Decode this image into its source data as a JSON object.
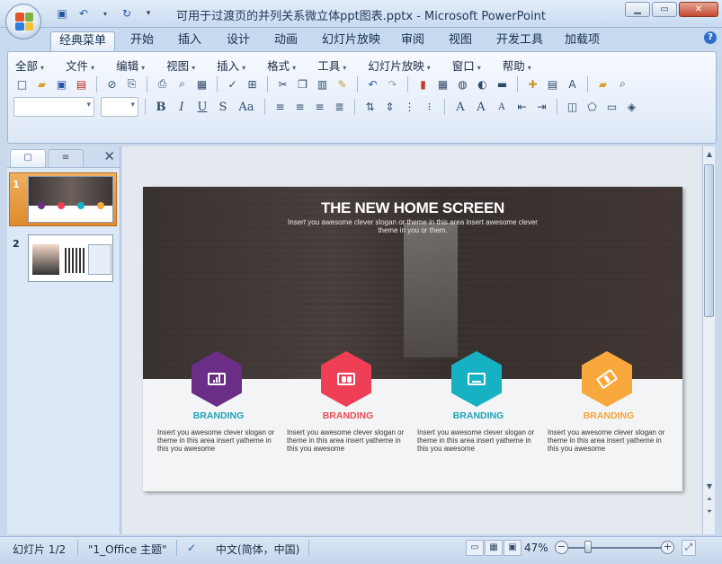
{
  "window": {
    "title": "可用于过渡页的并列关系微立体ppt图表.pptx - Microsoft PowerPoint"
  },
  "ribbon_tabs": [
    "经典菜单",
    "开始",
    "插入",
    "设计",
    "动画",
    "幻灯片放映",
    "审阅",
    "视图",
    "开发工具",
    "加载项"
  ],
  "menus": [
    "全部",
    "文件",
    "编辑",
    "视图",
    "插入",
    "格式",
    "工具",
    "幻灯片放映",
    "窗口",
    "帮助"
  ],
  "slide_pane": {
    "slides": [
      {
        "number": "1",
        "selected": true
      },
      {
        "number": "2",
        "selected": false
      }
    ]
  },
  "slide": {
    "title": "THE NEW HOME SCREEN",
    "subtitle": "Insert you awesome clever slogan or theme in this area insert awesome clever theme in you or them.",
    "cards": [
      {
        "title": "BRANDING",
        "color": "#6b2e86",
        "title_color": "#1fa3b5",
        "text": "Insert you awesome clever slogan or theme in this area insert yatheme in this you awesome",
        "icon": "chart-icon"
      },
      {
        "title": "BRANDING",
        "color": "#ef3f56",
        "title_color": "#ea4b5b",
        "text": "Insert you awesome clever slogan or theme in this area insert yatheme in this you awesome",
        "icon": "people-icon"
      },
      {
        "title": "BRANDING",
        "color": "#16b2c4",
        "title_color": "#1fa3b5",
        "text": "Insert you awesome clever slogan or theme in this area insert yatheme in this you awesome",
        "icon": "document-icon"
      },
      {
        "title": "BRANDING",
        "color": "#f8a83c",
        "title_color": "#f6a534",
        "text": "Insert you awesome clever slogan or theme in this area insert yatheme in this you awesome",
        "icon": "hammer-icon"
      }
    ]
  },
  "status": {
    "slide_counter": "幻灯片 1/2",
    "theme": "\"1_Office 主题\"",
    "language": "中文(简体，中国)",
    "zoom": "47%"
  }
}
